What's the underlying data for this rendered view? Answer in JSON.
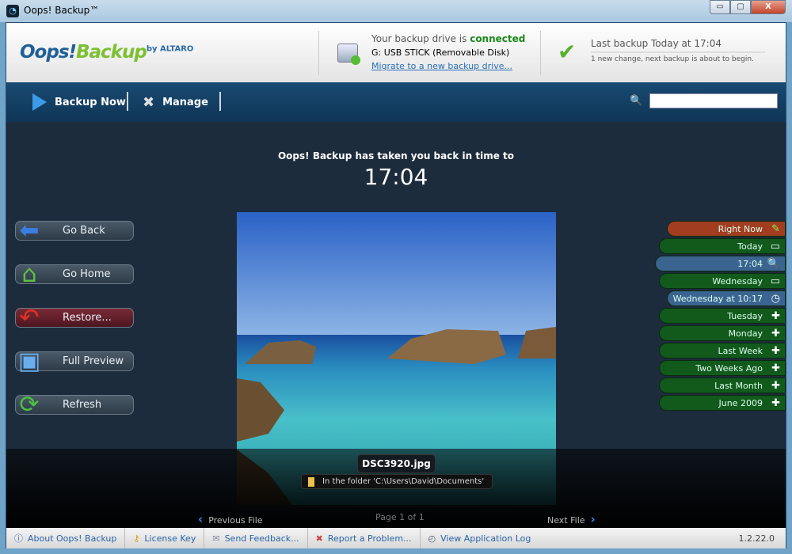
{
  "window": {
    "title": "Oops! Backup™",
    "minimize": "▭",
    "maximize": "▢",
    "close": "X"
  },
  "header": {
    "logo_oops": "Oops!",
    "logo_backup": "Backup",
    "logo_by": "by ALTARO",
    "drive_status_prefix": "Your backup drive is ",
    "drive_status": "connected",
    "drive_name": "G: USB STICK (Removable Disk)",
    "migrate_link": "Migrate to a new backup drive...",
    "last_backup": "Last backup Today at 17:04",
    "last_backup_detail": "1 new change, next backup is about to begin."
  },
  "nav": {
    "backup_now": "Backup Now",
    "manage": "Manage",
    "search_placeholder": ""
  },
  "main": {
    "heading": "Oops! Backup has taken you back in time to",
    "time": "17:04"
  },
  "actions": [
    "Go Back",
    "Go Home",
    "Restore...",
    "Full Preview",
    "Refresh"
  ],
  "timeline": [
    {
      "label": "Right Now",
      "icon": "pencil-icon"
    },
    {
      "label": "Today",
      "icon": "minus-icon"
    },
    {
      "label": "17:04",
      "icon": "magnifier-icon"
    },
    {
      "label": "Wednesday",
      "icon": "minus-icon"
    },
    {
      "label": "Wednesday at 10:17",
      "icon": "clock-icon"
    },
    {
      "label": "Tuesday",
      "icon": "plus-icon"
    },
    {
      "label": "Monday",
      "icon": "plus-icon"
    },
    {
      "label": "Last Week",
      "icon": "plus-icon"
    },
    {
      "label": "Two Weeks Ago",
      "icon": "plus-icon"
    },
    {
      "label": "Last Month",
      "icon": "plus-icon"
    },
    {
      "label": "June 2009",
      "icon": "plus-icon"
    }
  ],
  "file": {
    "name": "DSC3920.jpg",
    "folder": "In the folder 'C:\\Users\\David\\Documents'"
  },
  "pager": {
    "previous": "Previous File",
    "page": "Page 1 of 1",
    "next": "Next File"
  },
  "footer": {
    "about": "About Oops! Backup",
    "license": "License Key",
    "feedback": "Send Feedback...",
    "report": "Report a Problem...",
    "log": "View Application Log",
    "version": "1.2.22.0"
  }
}
